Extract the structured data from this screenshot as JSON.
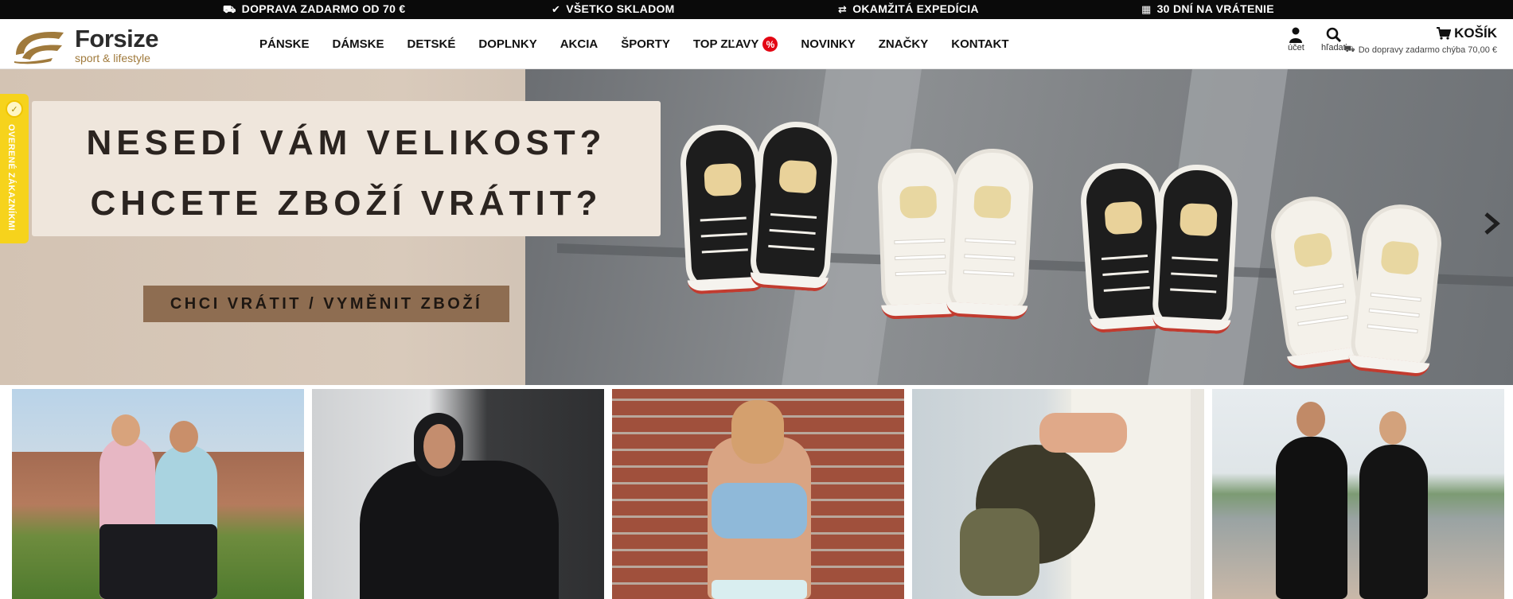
{
  "topbar": {
    "items": [
      {
        "icon": "truck-icon",
        "glyph": "⛟",
        "label": "DOPRAVA ZADARMO OD 70 €"
      },
      {
        "icon": "check-icon",
        "glyph": "✔",
        "label": "VŠETKO SKLADOM"
      },
      {
        "icon": "exchange-icon",
        "glyph": "⇄",
        "label": "OKAMŽITÁ EXPEDÍCIA"
      },
      {
        "icon": "calendar-icon",
        "glyph": "▦",
        "label": "30 DNÍ NA VRÁTENIE"
      }
    ],
    "bg_color": "#0a0a0a"
  },
  "header": {
    "logo": {
      "name": "Forsize",
      "tagline": "sport & lifestyle",
      "color": "#a07a3c"
    },
    "nav": [
      {
        "label": "PÁNSKE"
      },
      {
        "label": "DÁMSKE"
      },
      {
        "label": "DETSKÉ"
      },
      {
        "label": "DOPLNKY"
      },
      {
        "label": "AKCIA"
      },
      {
        "label": "ŠPORTY"
      },
      {
        "label": "TOP ZĽAVY",
        "badge": "%"
      },
      {
        "label": "NOVINKY"
      },
      {
        "label": "ZNAČKY"
      },
      {
        "label": "KONTAKT"
      }
    ],
    "account": {
      "label": "účet",
      "icon": "user-icon"
    },
    "search": {
      "label": "hľadať",
      "icon": "search-icon"
    },
    "cart": {
      "label": "KOŠÍK",
      "icon": "cart-icon",
      "note": "Do dopravy zadarmo chýba 70,00 €"
    }
  },
  "hero": {
    "line1": "NESEDÍ VÁM VELIKOST?",
    "line2": "CHCETE ZBOŽÍ VRÁTIT?",
    "cta": "CHCI VRÁTIT / VYMĚNIT ZBOŽÍ",
    "accent": "#8e6d51"
  },
  "verified_badge": {
    "label": "OVERENÉ ZÁKAZNÍKMI",
    "color": "#f6d31c"
  },
  "tiles": [
    {
      "name": "tile-women"
    },
    {
      "name": "tile-men"
    },
    {
      "name": "tile-kids"
    },
    {
      "name": "tile-accessories"
    },
    {
      "name": "tile-sports"
    }
  ]
}
